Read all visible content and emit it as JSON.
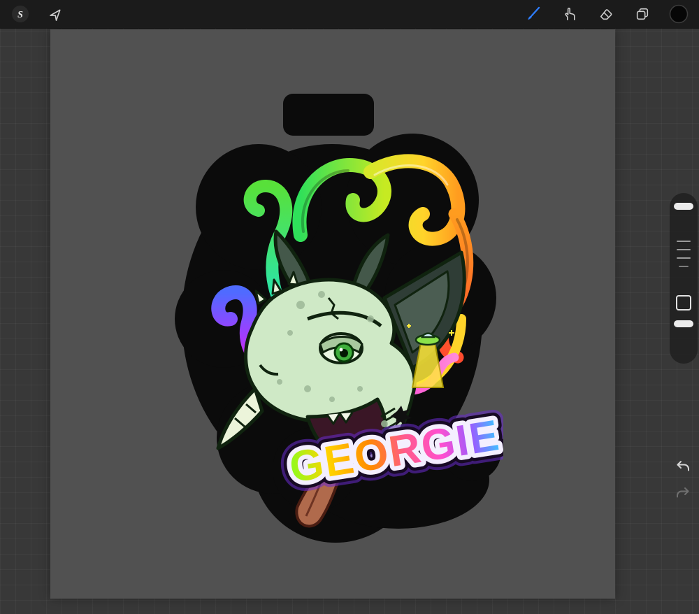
{
  "toolbar": {
    "left": [
      {
        "name": "selection-tool",
        "label": "S"
      },
      {
        "name": "transform-tool"
      }
    ],
    "right": [
      {
        "name": "brush-tool",
        "active": true
      },
      {
        "name": "smudge-tool",
        "active": false
      },
      {
        "name": "eraser-tool",
        "active": false
      },
      {
        "name": "layers",
        "active": false
      },
      {
        "name": "color-swatch",
        "value": "#0a0a0a"
      }
    ],
    "accent_color": "#2e7bf6"
  },
  "sidebar": {
    "controls": [
      "brush-size-slider",
      "modify-button",
      "opacity-slider"
    ],
    "history": [
      "undo",
      "redo"
    ]
  },
  "artwork": {
    "title": "GEORGIE",
    "palette": [
      "#21e6c1",
      "#58e03a",
      "#ffd42a",
      "#ff9c1f",
      "#ff4b2e",
      "#ff2bd6",
      "#a33bff",
      "#4f6bff",
      "#cfe9c6",
      "#b06a4c"
    ],
    "sticker_outline": "#0b0b0b"
  },
  "colors": {
    "topbar": "#1b1b1b",
    "workspace": "#383838",
    "canvas": "#515151"
  }
}
